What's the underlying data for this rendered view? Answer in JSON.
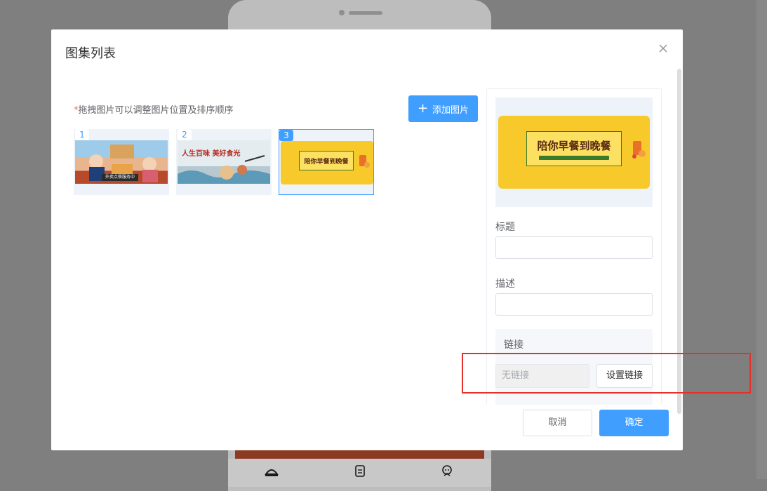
{
  "background": {
    "tab_icons": [
      "cloche-icon",
      "clipboard-icon",
      "face-icon"
    ]
  },
  "dialog": {
    "title": "图集列表",
    "hint_star": "*",
    "hint_text": "拖拽图片可以调整图片位置及排序顺序",
    "add_button_label": "添加图片",
    "thumbnails": [
      {
        "number": "1",
        "caption": "外卖点餐服务中"
      },
      {
        "number": "2",
        "caption": "人生百味 美好食光"
      },
      {
        "number": "3",
        "caption": "陪你早餐到晚餐"
      }
    ],
    "selected_index": 3,
    "panel": {
      "banner_text": "陪你早餐到晚餐",
      "title_label": "标题",
      "title_value": "",
      "desc_label": "描述",
      "desc_value": "",
      "link_label": "链接",
      "link_value": "无链接",
      "set_link_label": "设置链接"
    },
    "cancel_label": "取消",
    "ok_label": "确定"
  },
  "colors": {
    "primary": "#409eff",
    "highlight": "#e8302a",
    "banner_yellow": "#f7c92a"
  }
}
